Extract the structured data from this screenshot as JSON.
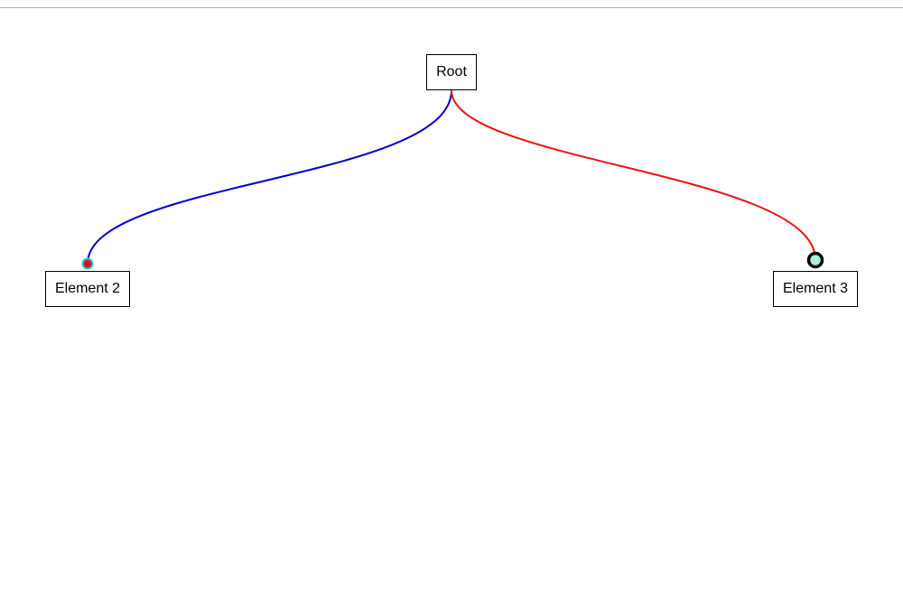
{
  "nodes": {
    "root": {
      "label": "Root"
    },
    "element2": {
      "label": "Element 2"
    },
    "element3": {
      "label": "Element 3"
    }
  },
  "connectors": [
    {
      "from": "root",
      "to": "element2",
      "stroke_color": "#0000cc",
      "endpoint_fill": "#dd1111",
      "endpoint_stroke": "#22c8dd"
    },
    {
      "from": "root",
      "to": "element3",
      "stroke_color": "#ee1111",
      "endpoint_fill": "#a8f0dc",
      "endpoint_stroke": "#000000"
    }
  ]
}
